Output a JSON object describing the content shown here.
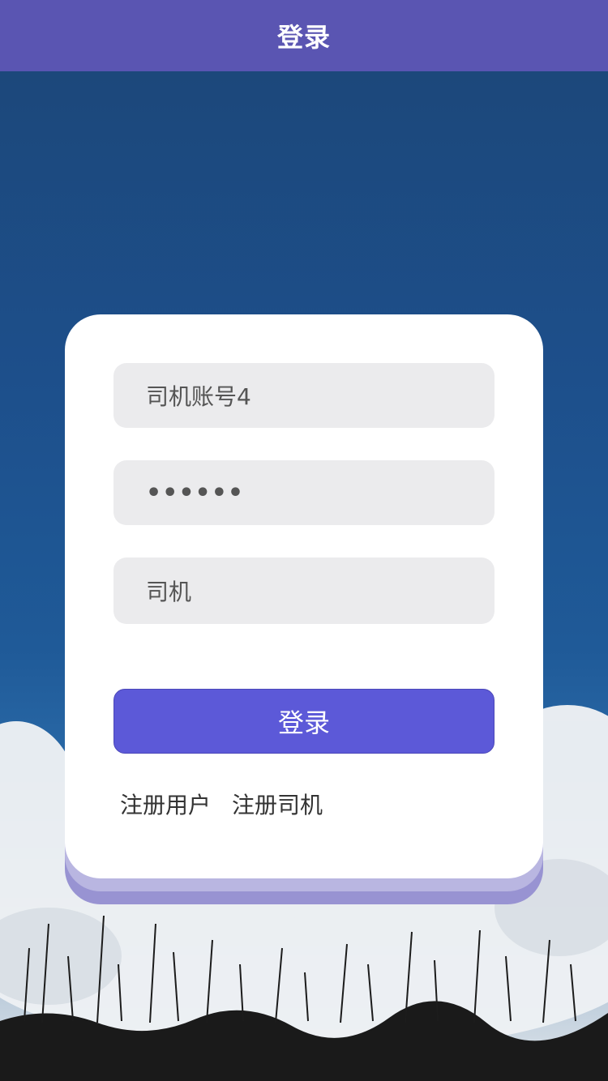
{
  "navbar": {
    "title": "登录"
  },
  "form": {
    "account_value": "司机账号4",
    "password_masked": "••••••",
    "role_value": "司机",
    "login_label": "登录"
  },
  "links": {
    "register_user": "注册用户",
    "register_driver": "注册司机"
  },
  "colors": {
    "navbar": "#5a55b2",
    "button": "#5c59d8",
    "card": "#ffffff",
    "field_bg": "#ebebed"
  },
  "background": {
    "scene": "blue-sky-with-clouds-and-grass-silhouette"
  }
}
